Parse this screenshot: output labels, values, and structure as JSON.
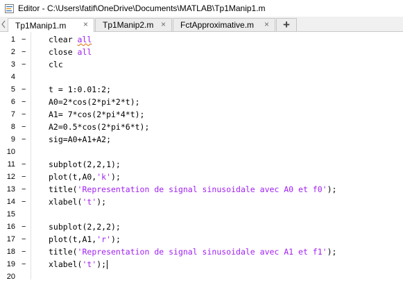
{
  "window": {
    "title": "Editor - C:\\Users\\fatif\\OneDrive\\Documents\\MATLAB\\Tp1Manip1.m",
    "icon": "matlab-editor-icon"
  },
  "tabs": [
    {
      "label": "Tp1Manip1.m",
      "active": true
    },
    {
      "label": "Tp1Manip2.m",
      "active": false
    },
    {
      "label": "FctApproximative.m",
      "active": false
    }
  ],
  "tab_close_glyph": "×",
  "new_tab_glyph": "+",
  "breakpoint_marker": "−",
  "colors": {
    "string": "#a020f0",
    "code": "#000000",
    "squiggle": "#e06a00"
  },
  "lines": [
    {
      "n": "1",
      "marker": true,
      "parts": [
        {
          "t": "clear "
        },
        {
          "t": "all",
          "cls": "str squiggle"
        }
      ]
    },
    {
      "n": "2",
      "marker": true,
      "parts": [
        {
          "t": "close "
        },
        {
          "t": "all",
          "cls": "str"
        }
      ]
    },
    {
      "n": "3",
      "marker": true,
      "parts": [
        {
          "t": "clc"
        }
      ]
    },
    {
      "n": "4",
      "marker": false,
      "parts": []
    },
    {
      "n": "5",
      "marker": true,
      "parts": [
        {
          "t": "t = 1:0.01:2;"
        }
      ]
    },
    {
      "n": "6",
      "marker": true,
      "parts": [
        {
          "t": "A0=2*cos(2*pi*2*t);"
        }
      ]
    },
    {
      "n": "7",
      "marker": true,
      "parts": [
        {
          "t": "A1= 7*cos(2*pi*4*t);"
        }
      ]
    },
    {
      "n": "8",
      "marker": true,
      "parts": [
        {
          "t": "A2=0.5*cos(2*pi*6*t);"
        }
      ]
    },
    {
      "n": "9",
      "marker": true,
      "parts": [
        {
          "t": "sig=A0+A1+A2;"
        }
      ]
    },
    {
      "n": "10",
      "marker": false,
      "parts": []
    },
    {
      "n": "11",
      "marker": true,
      "parts": [
        {
          "t": "subplot(2,2,1);"
        }
      ]
    },
    {
      "n": "12",
      "marker": true,
      "parts": [
        {
          "t": "plot(t,A0,"
        },
        {
          "t": "'k'",
          "cls": "str"
        },
        {
          "t": ");"
        }
      ]
    },
    {
      "n": "13",
      "marker": true,
      "parts": [
        {
          "t": "title("
        },
        {
          "t": "'Representation de signal sinusoidale avec A0 et f0'",
          "cls": "str"
        },
        {
          "t": ");"
        }
      ]
    },
    {
      "n": "14",
      "marker": true,
      "parts": [
        {
          "t": "xlabel("
        },
        {
          "t": "'t'",
          "cls": "str"
        },
        {
          "t": ");"
        }
      ]
    },
    {
      "n": "15",
      "marker": false,
      "parts": []
    },
    {
      "n": "16",
      "marker": true,
      "parts": [
        {
          "t": "subplot(2,2,2);"
        }
      ]
    },
    {
      "n": "17",
      "marker": true,
      "parts": [
        {
          "t": "plot(t,A1,"
        },
        {
          "t": "'r'",
          "cls": "str"
        },
        {
          "t": ");"
        }
      ]
    },
    {
      "n": "18",
      "marker": true,
      "parts": [
        {
          "t": "title("
        },
        {
          "t": "'Representation de signal sinusoidale avec A1 et f1'",
          "cls": "str"
        },
        {
          "t": ");"
        }
      ]
    },
    {
      "n": "19",
      "marker": true,
      "parts": [
        {
          "t": "xlabel("
        },
        {
          "t": "'t'",
          "cls": "str"
        },
        {
          "t": ");"
        }
      ],
      "cursor": true
    },
    {
      "n": "20",
      "marker": false,
      "parts": []
    }
  ]
}
